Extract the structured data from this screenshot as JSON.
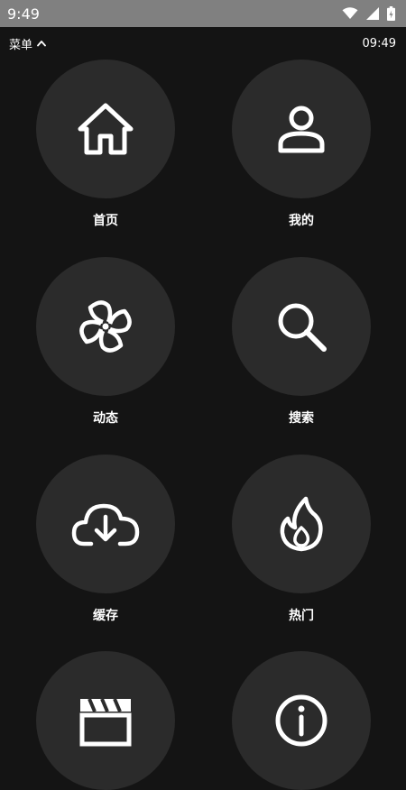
{
  "status_bar": {
    "time": "9:49"
  },
  "top_bar": {
    "menu_label": "菜单",
    "clock": "09:49"
  },
  "menu_items": [
    {
      "label": "首页",
      "icon": "home-icon"
    },
    {
      "label": "我的",
      "icon": "user-icon"
    },
    {
      "label": "动态",
      "icon": "fan-icon"
    },
    {
      "label": "搜索",
      "icon": "search-icon"
    },
    {
      "label": "缓存",
      "icon": "cloud-download-icon"
    },
    {
      "label": "热门",
      "icon": "fire-icon"
    },
    {
      "label": "",
      "icon": "clapperboard-icon"
    },
    {
      "label": "",
      "icon": "info-icon"
    }
  ],
  "colors": {
    "background": "#141414",
    "status_bar": "#808080",
    "circle": "#2b2b2b",
    "text": "#ffffff"
  }
}
